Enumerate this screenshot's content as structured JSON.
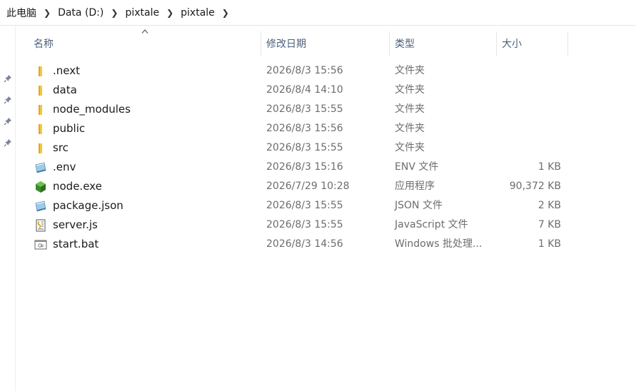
{
  "breadcrumb": [
    "此电脑",
    "Data (D:)",
    "pixtale",
    "pixtale"
  ],
  "columns": {
    "name": "名称",
    "date": "修改日期",
    "type": "类型",
    "size": "大小"
  },
  "files": [
    {
      "name": ".next",
      "date": "2026/8/3 15:56",
      "type": "文件夹",
      "size": "",
      "icon": "folder-icon"
    },
    {
      "name": "data",
      "date": "2026/8/4 14:10",
      "type": "文件夹",
      "size": "",
      "icon": "folder-icon"
    },
    {
      "name": "node_modules",
      "date": "2026/8/3 15:55",
      "type": "文件夹",
      "size": "",
      "icon": "folder-icon"
    },
    {
      "name": "public",
      "date": "2026/8/3 15:56",
      "type": "文件夹",
      "size": "",
      "icon": "folder-icon"
    },
    {
      "name": "src",
      "date": "2026/8/3 15:55",
      "type": "文件夹",
      "size": "",
      "icon": "folder-icon"
    },
    {
      "name": ".env",
      "date": "2026/8/3 15:16",
      "type": "ENV 文件",
      "size": "1 KB",
      "icon": "generic-file-icon"
    },
    {
      "name": "node.exe",
      "date": "2026/7/29 10:28",
      "type": "应用程序",
      "size": "90,372 KB",
      "icon": "nodejs-icon"
    },
    {
      "name": "package.json",
      "date": "2026/8/3 15:55",
      "type": "JSON 文件",
      "size": "2 KB",
      "icon": "generic-file-icon"
    },
    {
      "name": "server.js",
      "date": "2026/8/3 15:55",
      "type": "JavaScript 文件",
      "size": "7 KB",
      "icon": "script-file-icon"
    },
    {
      "name": "start.bat",
      "date": "2026/8/3 14:56",
      "type": "Windows 批处理...",
      "size": "1 KB",
      "icon": "batch-file-icon"
    }
  ],
  "colors": {
    "folder": "#f8c73e",
    "header_text": "#4c607a",
    "meta_text": "#6d6d6d"
  }
}
